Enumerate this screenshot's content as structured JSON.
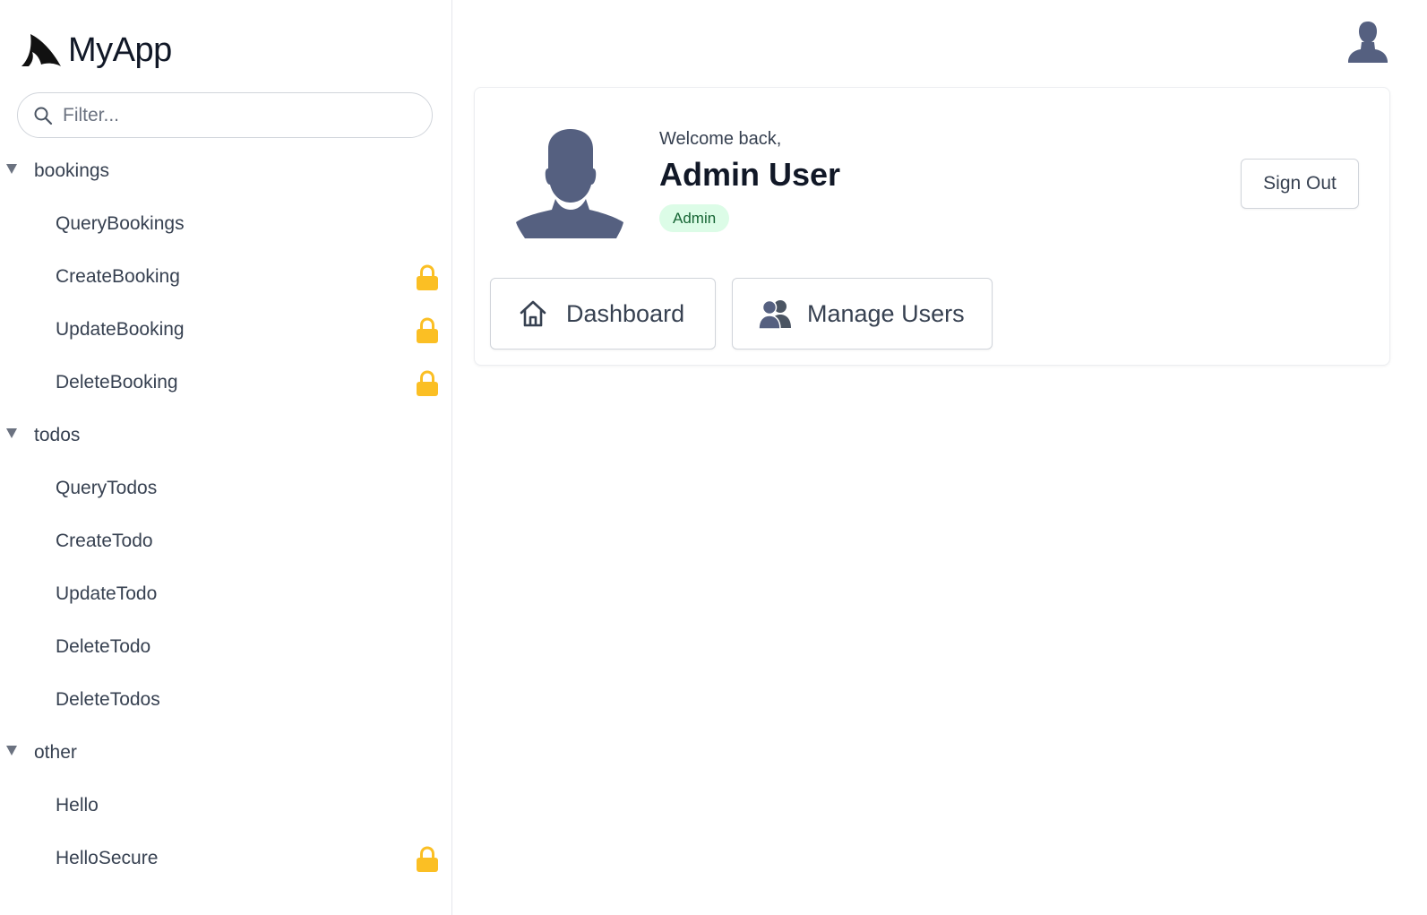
{
  "app": {
    "name": "MyApp"
  },
  "sidebar": {
    "filter_placeholder": "Filter...",
    "groups": [
      {
        "label": "bookings",
        "items": [
          {
            "label": "QueryBookings",
            "locked": false
          },
          {
            "label": "CreateBooking",
            "locked": true
          },
          {
            "label": "UpdateBooking",
            "locked": true
          },
          {
            "label": "DeleteBooking",
            "locked": true
          }
        ]
      },
      {
        "label": "todos",
        "items": [
          {
            "label": "QueryTodos",
            "locked": false
          },
          {
            "label": "CreateTodo",
            "locked": false
          },
          {
            "label": "UpdateTodo",
            "locked": false
          },
          {
            "label": "DeleteTodo",
            "locked": false
          },
          {
            "label": "DeleteTodos",
            "locked": false
          }
        ]
      },
      {
        "label": "other",
        "items": [
          {
            "label": "Hello",
            "locked": false
          },
          {
            "label": "HelloSecure",
            "locked": true
          }
        ]
      }
    ]
  },
  "profile": {
    "welcome": "Welcome back,",
    "name": "Admin User",
    "role": "Admin",
    "sign_out_label": "Sign Out"
  },
  "actions": {
    "dashboard_label": "Dashboard",
    "manage_users_label": "Manage Users"
  },
  "icons": {
    "logo": "shark-fin-logo-icon",
    "search": "search-icon",
    "caret": "caret-down-icon",
    "lock": "lock-icon",
    "avatar": "user-silhouette-icon",
    "home": "home-icon",
    "users": "users-icon"
  },
  "colors": {
    "lock": "#fbbf24",
    "avatar": "#556080",
    "badge_bg": "#dcfce7",
    "badge_text": "#166534"
  }
}
